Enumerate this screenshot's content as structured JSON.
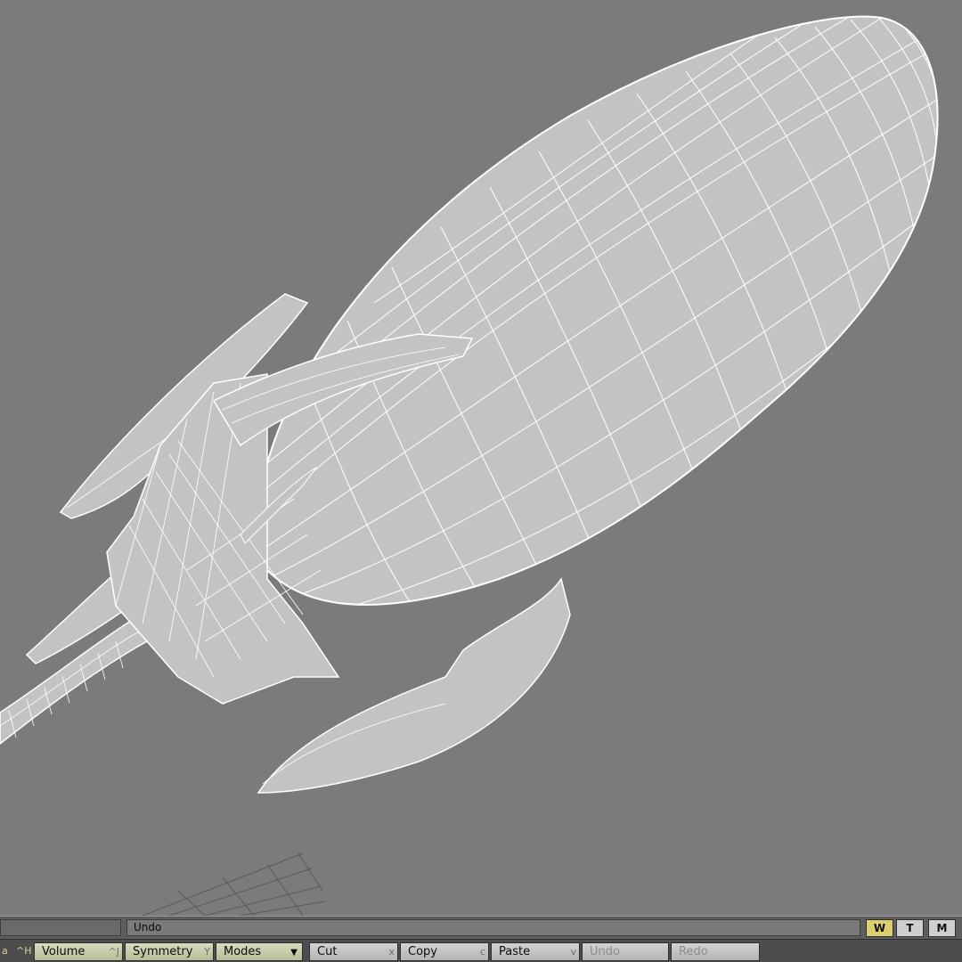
{
  "status": {
    "message": "Undo",
    "layout_buttons": [
      {
        "label": "W",
        "active": true
      },
      {
        "label": "T",
        "active": false
      },
      {
        "label": "M",
        "active": false
      }
    ]
  },
  "toolbar": {
    "left_key_1": "a",
    "left_key_2": "^H",
    "volume": {
      "label": "Volume",
      "key": "^J"
    },
    "symmetry": {
      "label": "Symmetry",
      "key": "Y"
    },
    "modes": {
      "label": "Modes",
      "arrow": "▼"
    },
    "cut": {
      "label": "Cut",
      "key": "x"
    },
    "copy": {
      "label": "Copy",
      "key": "c"
    },
    "paste": {
      "label": "Paste",
      "key": "v"
    },
    "undo": {
      "label": "Undo"
    },
    "redo": {
      "label": "Redo"
    }
  },
  "colors": {
    "viewport_bg": "#7b7b7b",
    "mesh_fill": "#c3c3c3",
    "wire": "#ffffff",
    "active_button": "#dccf6e"
  }
}
